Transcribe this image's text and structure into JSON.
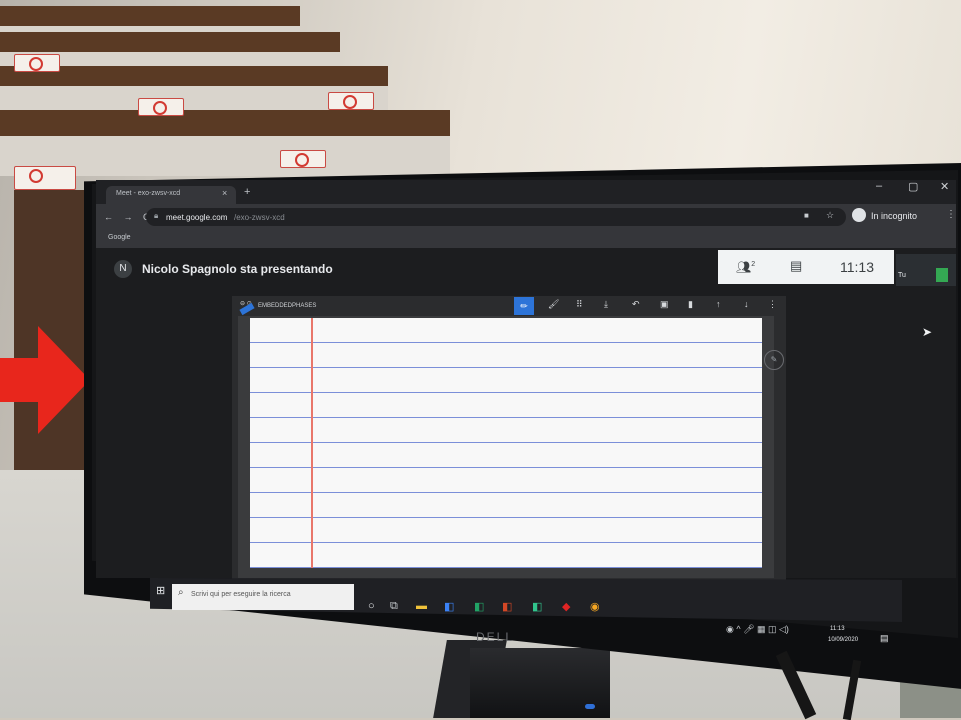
{
  "browser": {
    "tab_title": "Meet - exo-zwsv-xcd",
    "tab_close": "×",
    "new_tab": "+",
    "window_controls": [
      "–",
      "▢",
      "✕"
    ],
    "nav_buttons": "← → C",
    "url_host": "meet.google.com",
    "url_path": "/exo-zwsv-xcd",
    "incognito_label": "In incognito",
    "menu": "⋮",
    "bookmark": "Google"
  },
  "meet": {
    "avatar_initial": "N",
    "presenting_text": "Nicolo Spagnolo sta presentando",
    "participants_count": "2",
    "time": "11:13",
    "self_label": "Tu"
  },
  "app": {
    "title": "⊖ ⊙",
    "brand": "EMBEDDEDPHASES",
    "toolbar": [
      "✏",
      "🖌",
      "⠿",
      "⤓",
      "↶",
      "▣",
      "▮",
      "↑",
      "↓",
      "⋮"
    ]
  },
  "taskbar": {
    "search_placeholder": "Scrivi qui per eseguire la ricerca",
    "clock_time": "11:13",
    "clock_date": "10/09/2020"
  },
  "monitor": {
    "brand": "DELL"
  },
  "colors": {
    "arrow": "#e8261c",
    "presenting_accent": "#2d74d8",
    "paper_margin": "#e9776b",
    "paper_lines": "#7b8fd9"
  }
}
